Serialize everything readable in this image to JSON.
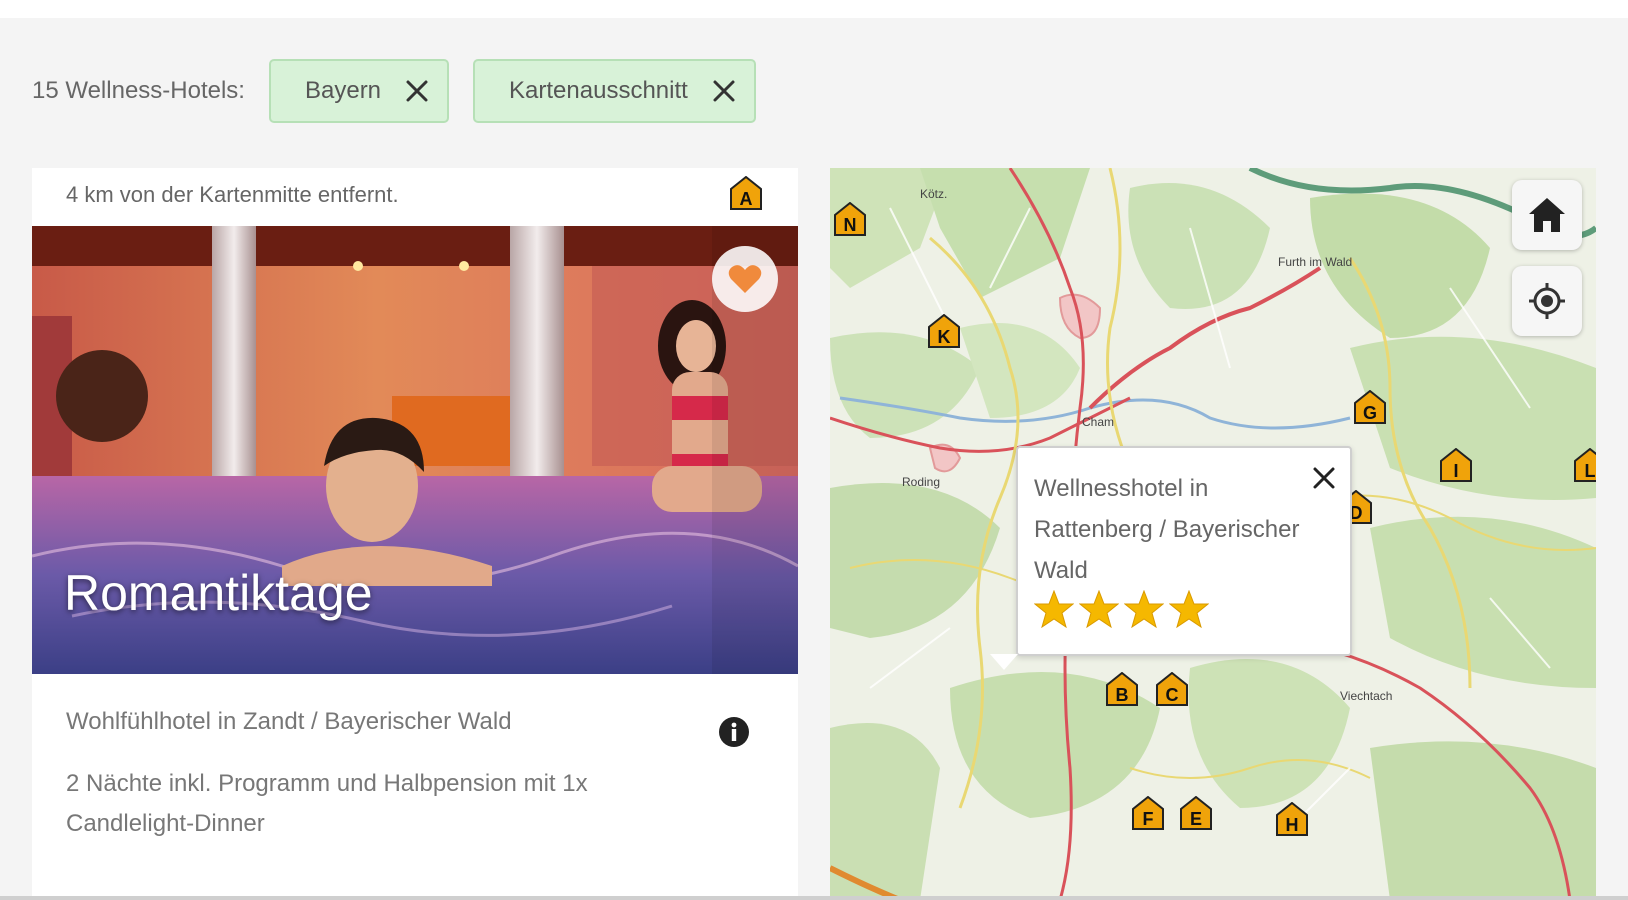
{
  "filters": {
    "count_label": "15 Wellness-Hotels:",
    "chips": [
      {
        "label": "Bayern"
      },
      {
        "label": "Kartenausschnitt"
      }
    ]
  },
  "card": {
    "distance": "4 km von der Kartenmitte entfernt.",
    "marker_letter": "A",
    "offer_title": "Romantiktage",
    "hotel_name": "Wohlfühlhotel in Zandt / Bayerischer Wald",
    "description": "2 Nächte inkl. Programm und Halbpension mit 1x Candlelight-Dinner"
  },
  "map": {
    "places": {
      "koetzting_top": "Kötz.",
      "furth": "Furth im Wald",
      "cham": "Cham",
      "roding": "Roding",
      "viechtach": "Viechtach"
    },
    "markers": [
      "N",
      "K",
      "G",
      "I",
      "L",
      "D",
      "B",
      "C",
      "F",
      "E",
      "H"
    ],
    "popup": {
      "title": "Wellnesshotel in Rattenberg / Bayerischer Wald",
      "stars": 4
    },
    "buttons": [
      "home-icon",
      "locate-icon"
    ]
  },
  "colors": {
    "marker": "#f0a30a",
    "chip_bg": "#d8f2d8",
    "star": "#f5b800",
    "heart": "#f08a3c"
  }
}
